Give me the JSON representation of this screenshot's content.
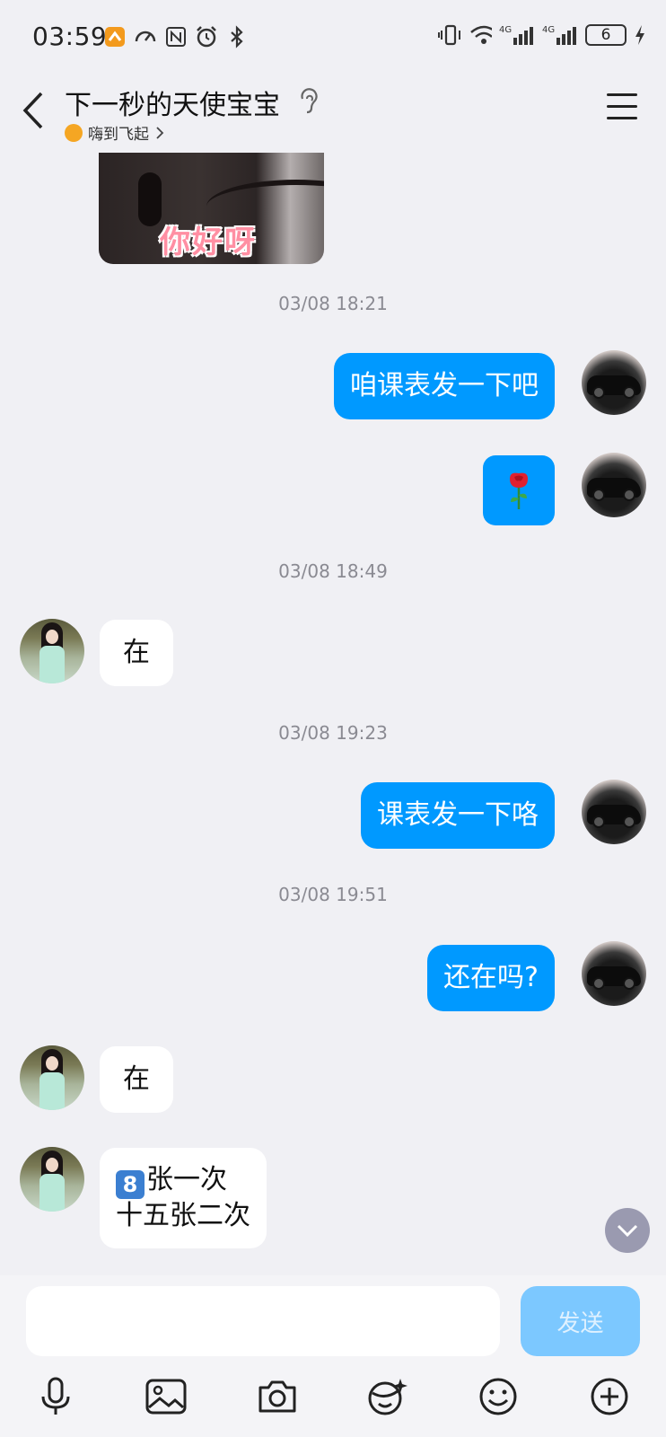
{
  "status_bar": {
    "time": "03:59",
    "battery_level": "6"
  },
  "header": {
    "title": "下一秒的天使宝宝",
    "subtitle": "嗨到飞起"
  },
  "messages": {
    "image_text": "你好呀",
    "ts1": "03/08 18:21",
    "m1": "咱课表发一下吧",
    "ts2": "03/08 18:49",
    "m3": "在",
    "ts3": "03/08 19:23",
    "m4": "课表发一下咯",
    "ts4": "03/08 19:51",
    "m5": "还在吗?",
    "m6": "在",
    "m7_badge": "8",
    "m7_line1": "张一次",
    "m7_line2": "十五张二次"
  },
  "input": {
    "placeholder": "",
    "send_label": "发送"
  },
  "colors": {
    "outgoing_bubble": "#0099ff",
    "incoming_bubble": "#ffffff",
    "background": "#f0f0f4"
  },
  "icons": [
    "mic-icon",
    "image-icon",
    "camera-icon",
    "sticker-icon",
    "emoji-icon",
    "plus-icon"
  ]
}
